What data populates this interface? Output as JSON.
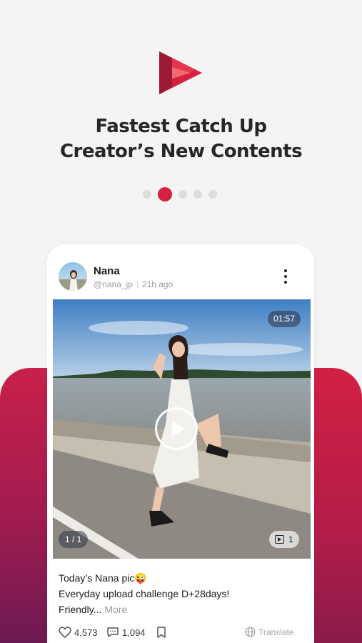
{
  "onboarding": {
    "headline_line1": "Fastest Catch Up",
    "headline_line2": "Creator’s New Contents",
    "pagination": {
      "total": 5,
      "current": 2
    },
    "accent_color": "#d5203f"
  },
  "post": {
    "author_name": "Nana",
    "author_handle": "@nana_jp",
    "posted_ago": "21h ago",
    "video_duration": "01:57",
    "media_pager": "1 / 1",
    "media_count": "1",
    "caption_line1": "Today’s Nana pic😜",
    "caption_line2": "Everyday upload challenge D+28days!",
    "caption_line3": "Friendly...",
    "more_label": "More",
    "likes": "4,573",
    "comments": "1,094",
    "translate_label": "Translate"
  },
  "icons": {
    "logo": "brand-logo-icon",
    "menu": "more-vertical-icon",
    "play": "play-icon",
    "like": "heart-icon",
    "comment": "comment-icon",
    "bookmark": "bookmark-icon",
    "translate": "globe-icon",
    "media_type": "video-icon"
  }
}
